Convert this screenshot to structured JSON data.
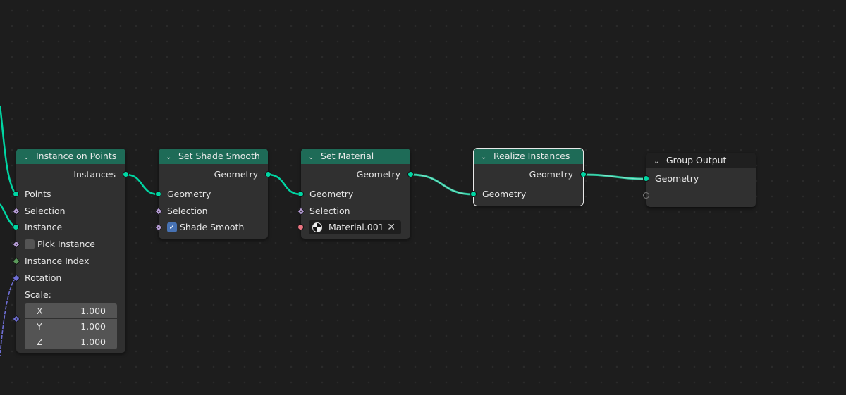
{
  "editor": "Geometry Node Editor",
  "colors": {
    "geometry_socket": "#00d6a3",
    "selection_socket": "#b99fd9",
    "integer_socket": "#5b9a5b",
    "rotation_socket": "#6f6fd6",
    "material_socket": "#eb7582",
    "node_header_geometry": "#1e6b57",
    "node_header_output": "#1f1f1f",
    "checkbox_on": "#4772b3"
  },
  "nodes": {
    "instance_on_points": {
      "title": "Instance on Points",
      "outputs": [
        {
          "label": "Instances",
          "type": "geometry"
        }
      ],
      "inputs": [
        {
          "label": "Points",
          "type": "geometry",
          "connected": true
        },
        {
          "label": "Selection",
          "type": "boolean-field"
        },
        {
          "label": "Instance",
          "type": "geometry",
          "connected": true
        },
        {
          "label": "Pick Instance",
          "type": "boolean",
          "checked": false
        },
        {
          "label": "Instance Index",
          "type": "integer-field"
        },
        {
          "label": "Rotation",
          "type": "rotation",
          "connected": true
        },
        {
          "label": "Scale:",
          "type": "vector"
        }
      ],
      "scale": [
        {
          "axis": "X",
          "value": "1.000"
        },
        {
          "axis": "Y",
          "value": "1.000"
        },
        {
          "axis": "Z",
          "value": "1.000"
        }
      ]
    },
    "set_shade_smooth": {
      "title": "Set Shade Smooth",
      "outputs": [
        {
          "label": "Geometry"
        }
      ],
      "inputs": [
        {
          "label": "Geometry",
          "connected": true
        },
        {
          "label": "Selection"
        },
        {
          "label": "Shade Smooth",
          "checked": true
        }
      ]
    },
    "set_material": {
      "title": "Set Material",
      "outputs": [
        {
          "label": "Geometry"
        }
      ],
      "inputs": [
        {
          "label": "Geometry",
          "connected": true
        },
        {
          "label": "Selection"
        },
        {
          "label": "Material",
          "value": "Material.001"
        }
      ],
      "material_clear_icon": "x-icon"
    },
    "realize_instances": {
      "title": "Realize Instances",
      "selected": true,
      "outputs": [
        {
          "label": "Geometry"
        }
      ],
      "inputs": [
        {
          "label": "Geometry",
          "connected": true
        }
      ]
    },
    "group_output": {
      "title": "Group Output",
      "inputs": [
        {
          "label": "Geometry",
          "connected": true
        },
        {
          "label": "",
          "type": "empty"
        }
      ]
    }
  },
  "icons": {
    "collapse": "chevron-down-icon",
    "checkmark": "checkmark-icon",
    "material": "material-sphere-icon",
    "clear": "x-icon"
  },
  "glyphs": {
    "chevron": "⌄",
    "check": "✓",
    "x": "✕"
  }
}
